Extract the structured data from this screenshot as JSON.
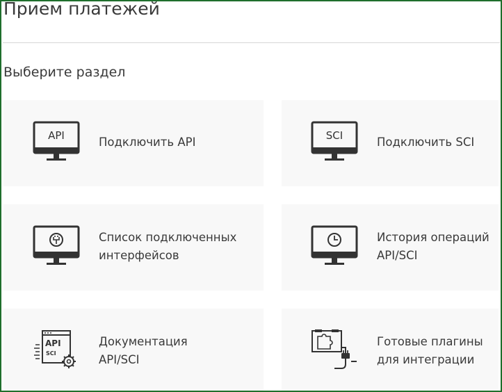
{
  "page": {
    "title": "Прием платежей",
    "section_title": "Выберите раздел"
  },
  "cards": [
    {
      "label": "Подключить API",
      "icon": "monitor-api-icon",
      "icon_text": "API"
    },
    {
      "label": "Подключить SCI",
      "icon": "monitor-sci-icon",
      "icon_text": "SCI"
    },
    {
      "label": "Список подключенных\nинтерфейсов",
      "icon": "monitor-plug-icon"
    },
    {
      "label": "История операций\nAPI/SCI",
      "icon": "monitor-clock-icon"
    },
    {
      "label": "Документация\nAPI/SCI",
      "icon": "documentation-gear-icon",
      "icon_text_1": "API",
      "icon_text_2": "SCI"
    },
    {
      "label": "Готовые плагины\nдля интеграции",
      "icon": "plugin-puzzle-icon"
    }
  ],
  "colors": {
    "frame": "#1f6e2c",
    "card_bg": "#f8f8f8",
    "icon": "#333333",
    "text": "#3a3a3a"
  }
}
